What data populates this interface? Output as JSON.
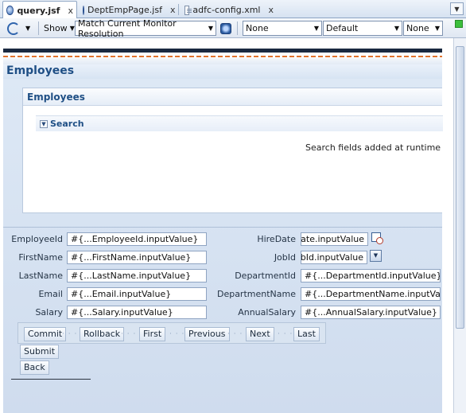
{
  "tabs": [
    {
      "label": "query.jsf",
      "icon": "jsf-page-icon",
      "active": true
    },
    {
      "label": "DeptEmpPage.jsf",
      "icon": "jsf-page-icon",
      "active": false
    },
    {
      "label": "adfc-config.xml",
      "icon": "xml-file-icon",
      "active": false
    }
  ],
  "tab_close_glyph": "x",
  "toolbar": {
    "show_label": "Show",
    "monitor_resolution": "Match Current Monitor Resolution",
    "combo1": "None",
    "combo2": "Default",
    "combo3": "None"
  },
  "page": {
    "title": "Employees",
    "panel_title": "Employees",
    "search_title": "Search",
    "search_note": "Search fields added at runtime"
  },
  "form_left": [
    {
      "label": "EmployeeId",
      "value": "#{...EmployeeId.inputValue}"
    },
    {
      "label": "FirstName",
      "value": "#{...FirstName.inputValue}"
    },
    {
      "label": "LastName",
      "value": "#{...LastName.inputValue}"
    },
    {
      "label": "Email",
      "value": "#{...Email.inputValue}"
    },
    {
      "label": "Salary",
      "value": "#{...Salary.inputValue}"
    }
  ],
  "form_right": [
    {
      "label": "HireDate",
      "value": "Date.inputValue}"
    },
    {
      "label": "JobId",
      "value": "JobId.inputValue}"
    },
    {
      "label": "DepartmentId",
      "value": "#{...DepartmentId.inputValue}"
    },
    {
      "label": "DepartmentName",
      "value": "#{...DepartmentName.inputValue}"
    },
    {
      "label": "AnnualSalary",
      "value": "#{...AnnualSalary.inputValue}"
    }
  ],
  "nav_buttons": [
    "Commit",
    "Rollback",
    "First",
    "Previous",
    "Next",
    "Last"
  ],
  "submit_label": "Submit",
  "back_label": "Back",
  "colors": {
    "accent": "#1f4f85",
    "brand_dark": "#1a2940",
    "brand_orange": "#e0732e"
  }
}
